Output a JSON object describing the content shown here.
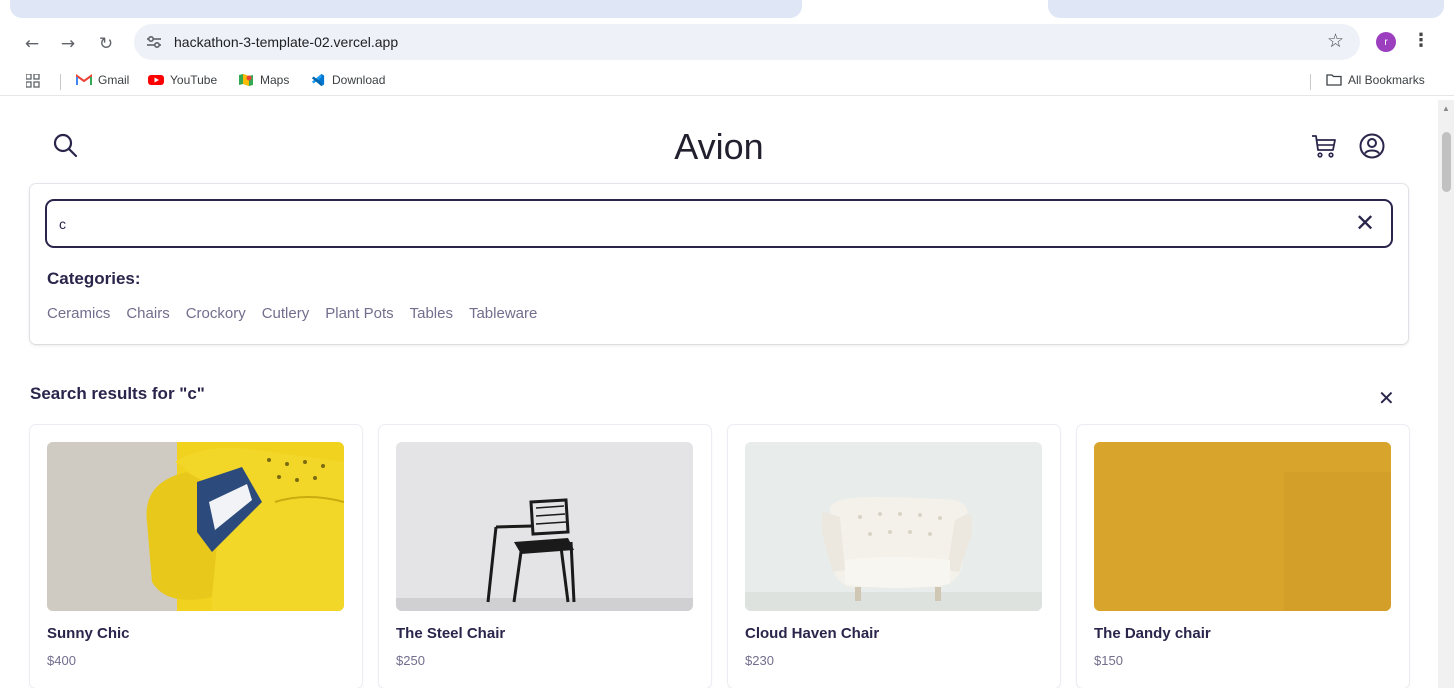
{
  "browser": {
    "url": "hackathon-3-template-02.vercel.app",
    "profile_initial": "r",
    "bookmarks": [
      {
        "label": "Gmail",
        "icon": "gmail-icon"
      },
      {
        "label": "YouTube",
        "icon": "youtube-icon"
      },
      {
        "label": "Maps",
        "icon": "maps-icon"
      },
      {
        "label": "Download",
        "icon": "vscode-icon"
      }
    ],
    "all_bookmarks_label": "All Bookmarks"
  },
  "header": {
    "brand": "Avion"
  },
  "search": {
    "value": "c",
    "categories_title": "Categories:",
    "categories": [
      "Ceramics",
      "Chairs",
      "Crockory",
      "Cutlery",
      "Plant Pots",
      "Tables",
      "Tableware"
    ]
  },
  "results": {
    "title": "Search results for \"c\"",
    "products": [
      {
        "name": "Sunny Chic",
        "price": "$400"
      },
      {
        "name": "The Steel Chair",
        "price": "$250"
      },
      {
        "name": "Cloud Haven Chair",
        "price": "$230"
      },
      {
        "name": "The Dandy chair",
        "price": "$150"
      }
    ]
  },
  "colors": {
    "primary": "#2a254b",
    "muted": "#726e8d",
    "omnibox_bg": "#eef1f8"
  }
}
